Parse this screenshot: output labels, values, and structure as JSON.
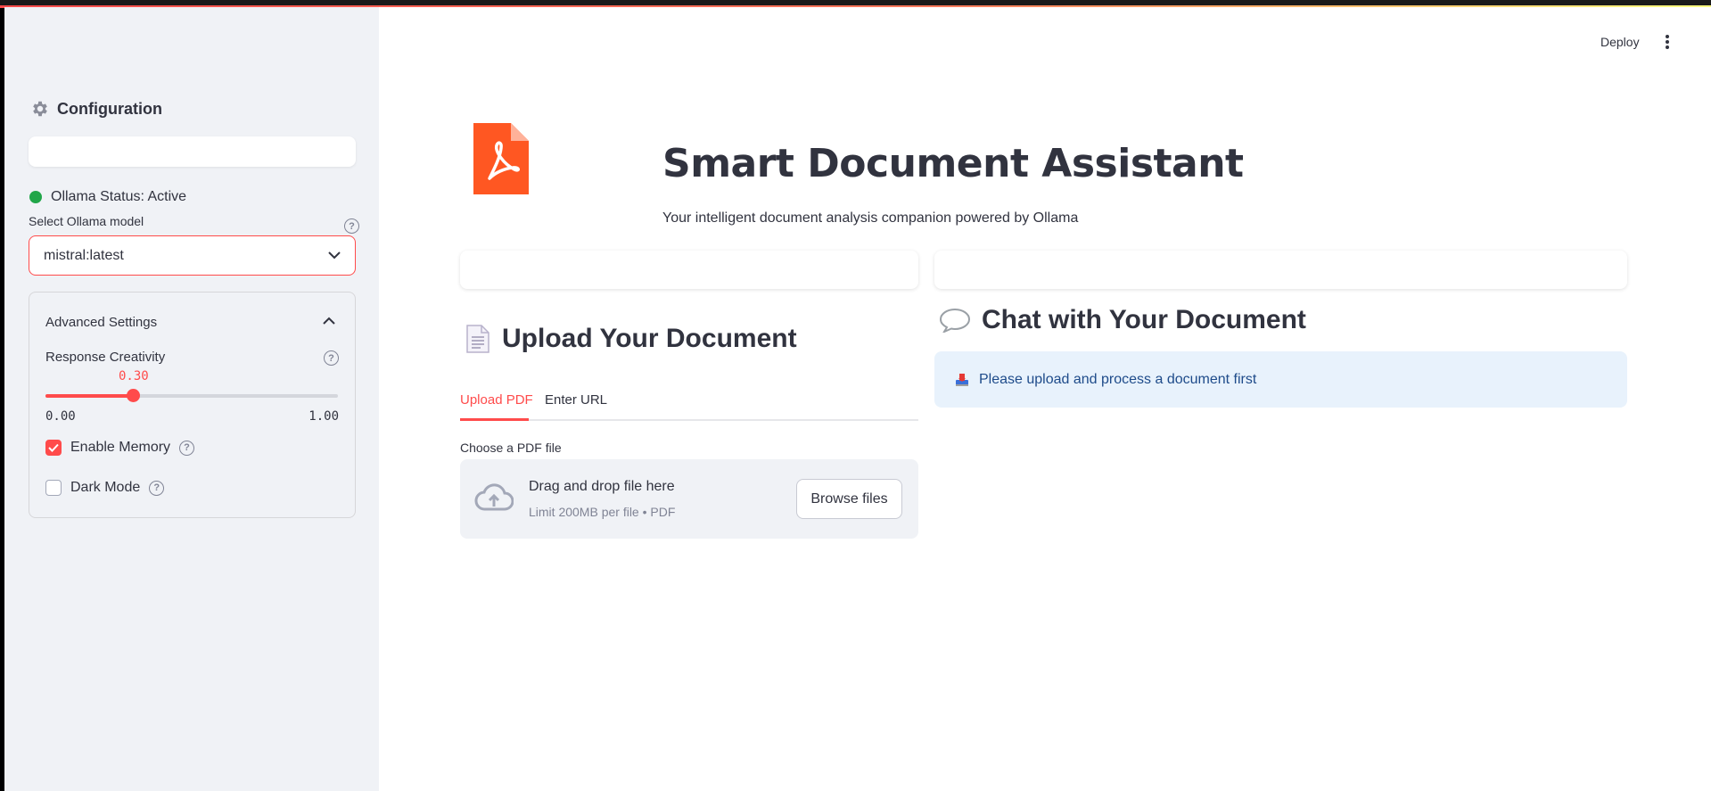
{
  "header": {
    "deploy_label": "Deploy"
  },
  "sidebar": {
    "config_title": "Configuration",
    "status_text": "Ollama Status: Active",
    "select_label": "Select Ollama model",
    "selected_model": "mistral:latest",
    "advanced": {
      "title": "Advanced Settings",
      "creativity_label": "Response Creativity",
      "creativity_value": "0.30",
      "creativity_fraction": 0.3,
      "min": "0.00",
      "max": "1.00",
      "memory_label": "Enable Memory",
      "memory_checked": true,
      "dark_label": "Dark Mode",
      "dark_checked": false
    }
  },
  "main": {
    "title": "Smart Document Assistant",
    "subtitle": "Your intelligent document analysis companion powered by Ollama",
    "upload": {
      "heading": "Upload Your Document",
      "tabs": [
        "Upload PDF",
        "Enter URL"
      ],
      "choose_label": "Choose a PDF file",
      "drop_main": "Drag and drop file here",
      "drop_sub": "Limit 200MB per file • PDF",
      "browse_label": "Browse files"
    },
    "chat": {
      "heading": "Chat with Your Document",
      "info": "Please upload and process a document first"
    }
  },
  "colors": {
    "accent": "#ff4b4b",
    "status_active": "#21a649",
    "info_bg": "#e8f2fc",
    "pdf_orange": "#ff5722"
  }
}
